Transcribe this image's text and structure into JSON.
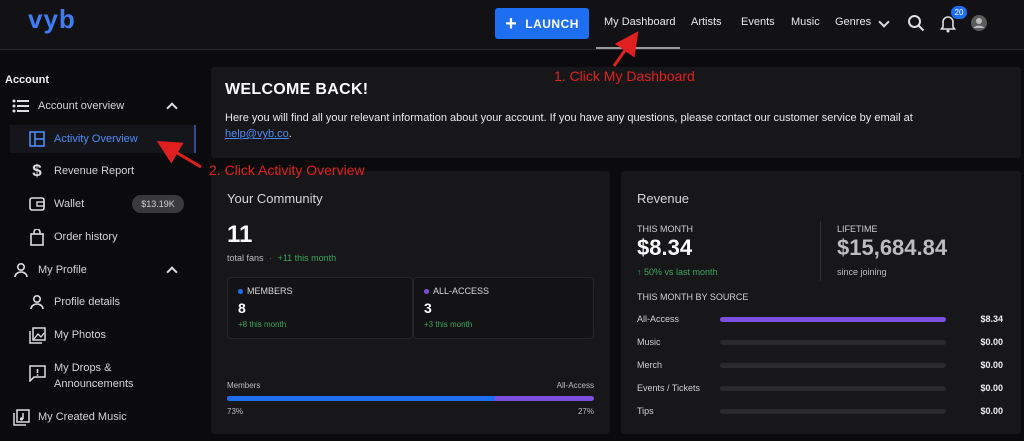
{
  "nav": {
    "logo": "vyb",
    "launch_label": "LAUNCH",
    "links": [
      "My Dashboard",
      "Artists",
      "Events",
      "Music",
      "Genres"
    ],
    "notification_count": "20"
  },
  "sidebar": {
    "title": "Account",
    "items": [
      {
        "label": "Account overview",
        "icon": "list-icon"
      },
      {
        "label": "Activity Overview",
        "icon": "layout-icon"
      },
      {
        "label": "Revenue Report",
        "icon": "dollar-icon"
      },
      {
        "label": "Wallet",
        "icon": "wallet-icon",
        "pill": "$13.19K"
      },
      {
        "label": "Order history",
        "icon": "bag-icon"
      },
      {
        "label": "My Profile",
        "icon": "person-icon"
      },
      {
        "label": "Profile details",
        "icon": "person-icon"
      },
      {
        "label": "My Photos",
        "icon": "photos-icon"
      },
      {
        "label": "My Drops &",
        "label2": "Announcements",
        "icon": "announcement-icon"
      },
      {
        "label": "My Created Music",
        "icon": "music-icon"
      }
    ]
  },
  "welcome": {
    "title": "WELCOME BACK!",
    "text": "Here you will find all your relevant information about your account. If you have any questions, please contact our customer service by email at",
    "email": "help@vyb.co",
    "period": "."
  },
  "community": {
    "title": "Your Community",
    "total": "11",
    "total_label": "total fans",
    "sep": "·",
    "growth": "+11 this month",
    "members_label": "MEMBERS",
    "members_value": "8",
    "members_growth": "+8 this month",
    "allaccess_label": "ALL-ACCESS",
    "allaccess_value": "3",
    "allaccess_growth": "+3 this month",
    "bar_left_label": "Members",
    "bar_right_label": "All-Access",
    "bar_left_pct": "73%",
    "bar_right_pct": "27%",
    "members_share": 0.73,
    "colors": {
      "members": "#1e6ef2",
      "allaccess": "#7b4fe0"
    }
  },
  "revenue": {
    "title": "Revenue",
    "this_month_label": "THIS MONTH",
    "this_month_value": "$8.34",
    "this_month_change": "↑ 50% vs last month",
    "lifetime_label": "LIFETIME",
    "lifetime_value": "$15,684.84",
    "lifetime_sub": "since joining",
    "by_source_label": "THIS MONTH BY SOURCE",
    "sources": [
      {
        "label": "All-Access",
        "value": "$8.34",
        "share": 1.0
      },
      {
        "label": "Music",
        "value": "$0.00",
        "share": 0
      },
      {
        "label": "Merch",
        "value": "$0.00",
        "share": 0
      },
      {
        "label": "Events / Tickets",
        "value": "$0.00",
        "share": 0
      },
      {
        "label": "Tips",
        "value": "$0.00",
        "share": 0
      }
    ]
  },
  "annotations": {
    "step1": "1. Click My Dashboard",
    "step2": "2. Click Activity Overview"
  }
}
